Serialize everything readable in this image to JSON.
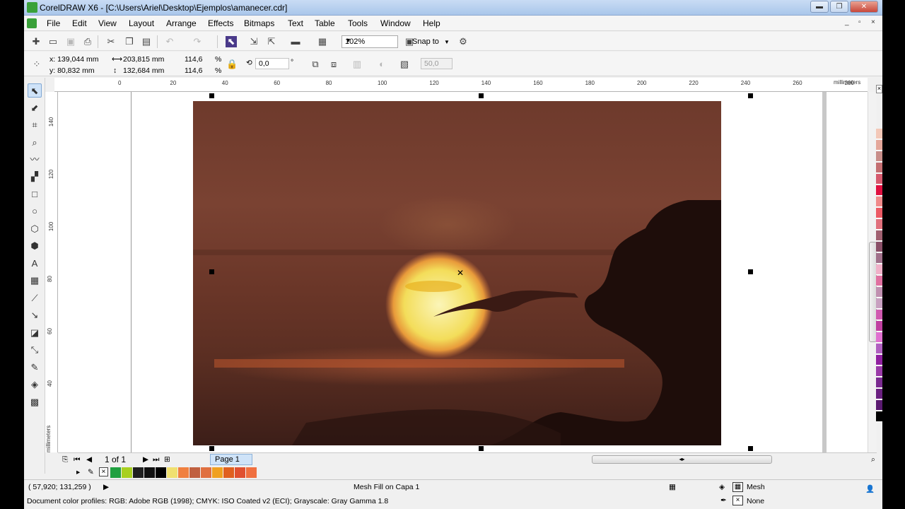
{
  "window": {
    "title": "CorelDRAW X6 - [C:\\Users\\Ariel\\Desktop\\Ejemplos\\amanecer.cdr]",
    "controls": {
      "minimize": "▬",
      "restore": "❐",
      "close": "✕"
    }
  },
  "menu": {
    "items": [
      "File",
      "Edit",
      "View",
      "Layout",
      "Arrange",
      "Effects",
      "Bitmaps",
      "Text",
      "Table",
      "Tools",
      "Window",
      "Help"
    ],
    "doc_controls": {
      "minimize": "_",
      "restore": "▫",
      "close": "×"
    }
  },
  "toolbar": {
    "zoom": "102%",
    "snap_to": "Snap to"
  },
  "property_bar": {
    "x": "x: 139,044 mm",
    "y": "y: 80,832 mm",
    "width": "203,815 mm",
    "height": "132,684 mm",
    "scale_x": "114,6",
    "scale_y": "114,6",
    "percent": "%",
    "rotation": "0,0",
    "degree": "°",
    "outline_width": "50,0"
  },
  "ruler": {
    "h_ticks": [
      "0",
      "20",
      "40",
      "60",
      "80",
      "100",
      "120",
      "140",
      "160",
      "180",
      "200",
      "220",
      "240",
      "260",
      "280"
    ],
    "units": "millimeters",
    "v_ticks": [
      "140",
      "120",
      "100",
      "80",
      "60",
      "40"
    ],
    "v_units": "millimeters"
  },
  "page_nav": {
    "page_count": "1 of 1",
    "page_tab": "Page 1"
  },
  "status": {
    "coordinates": "( 57,920; 131,259 )",
    "object_info": "Mesh Fill on Capa 1",
    "fill_label": "Mesh",
    "outline_label": "None",
    "color_profiles": "Document color profiles: RGB: Adobe RGB (1998); CMYK: ISO Coated v2 (ECI); Grayscale: Gray Gamma 1.8"
  },
  "colors": {
    "palette": [
      "#f3c8b8",
      "#e4a79a",
      "#c88e8a",
      "#c46f72",
      "#d65a6e",
      "#e01040",
      "#f08a8a",
      "#ec5a64",
      "#e0707c",
      "#a06070",
      "#8a5068",
      "#a0708a",
      "#f0b0c8",
      "#e070a0",
      "#c090b0",
      "#c8a0c0",
      "#d05ab0",
      "#c040a0",
      "#e070d0",
      "#b060c0",
      "#9020a0",
      "#9a3aa8",
      "#7a2a90",
      "#6a2080",
      "#5a1a70",
      "#000000"
    ],
    "document_palette": [
      "#20a040",
      "#a8d020",
      "#202020",
      "#101010",
      "#000000",
      "#f0e070",
      "#f08040",
      "#c06040",
      "#e07040",
      "#f0a020",
      "#e06020",
      "#e05030",
      "#f07040"
    ],
    "accent": "#3aa13a",
    "selection": "#cfe3f8"
  },
  "icons": {
    "tools": [
      "pick-tool-icon",
      "shape-tool-icon",
      "crop-tool-icon",
      "zoom-tool-icon",
      "freehand-tool-icon",
      "smart-fill-icon",
      "rectangle-tool-icon",
      "ellipse-tool-icon",
      "polygon-tool-icon",
      "basic-shapes-icon",
      "text-tool-icon",
      "table-tool-icon",
      "dimension-tool-icon",
      "connector-tool-icon",
      "blend-tool-icon",
      "eyedropper-tool-icon",
      "outline-pen-icon",
      "fill-tool-icon",
      "interactive-fill-icon"
    ]
  }
}
